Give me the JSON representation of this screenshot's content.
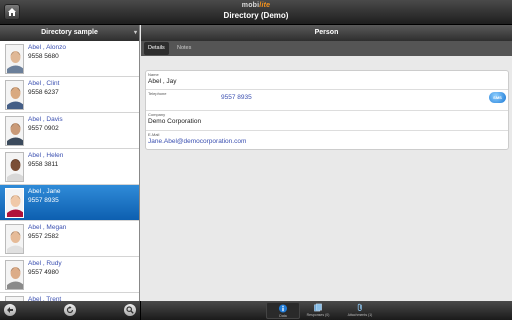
{
  "topbar": {
    "brand_part1": "mobi",
    "brand_part2": "lite",
    "title": "Directory (Demo)"
  },
  "left_panel": {
    "header": "Directory sample",
    "contacts": [
      {
        "name": "Abel , Alonzo",
        "phone": "9558 5680",
        "selected": false
      },
      {
        "name": "Abel , Clint",
        "phone": "9558 6237",
        "selected": false
      },
      {
        "name": "Abel , Davis",
        "phone": "9557 0902",
        "selected": false
      },
      {
        "name": "Abel , Helen",
        "phone": "9558 3811",
        "selected": false
      },
      {
        "name": "Abel , Jane",
        "phone": "9557 8935",
        "selected": true
      },
      {
        "name": "Abel , Megan",
        "phone": "9557 2582",
        "selected": false
      },
      {
        "name": "Abel , Rudy",
        "phone": "9557 4980",
        "selected": false
      },
      {
        "name": "Abel , Trent",
        "phone": "",
        "selected": false
      }
    ]
  },
  "right_panel": {
    "header": "Person",
    "tabs": [
      {
        "label": "Details",
        "active": true
      },
      {
        "label": "Notes",
        "active": false
      }
    ],
    "fields": {
      "name_label": "Name",
      "name_value": "Abel , Jay",
      "telephone_label": "Telephone",
      "telephone_value": "9557 8935",
      "sms_label": "SMS",
      "company_label": "Company",
      "company_value": "Demo Corporation",
      "email_label": "E-Mail",
      "email_value": "Jane.Abel@democorporation.com"
    }
  },
  "bottom_tabs": [
    {
      "label": "Data",
      "icon": "info-icon",
      "active": true
    },
    {
      "label": "Responses (0)",
      "icon": "responses-icon",
      "active": false
    },
    {
      "label": "Attachments (1)",
      "icon": "paperclip-icon",
      "active": false
    }
  ],
  "colors": {
    "accent": "#1a73c8",
    "link": "#3a4fb0",
    "brand_orange": "#f7941d"
  }
}
